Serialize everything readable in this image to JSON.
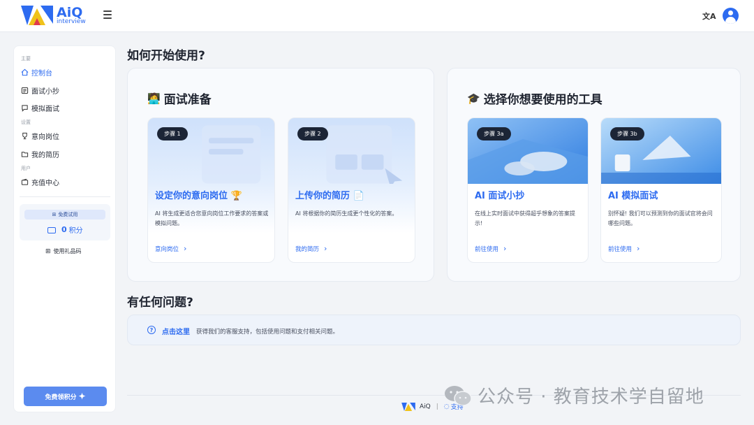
{
  "brand": {
    "word": "AiQ",
    "sub": "interview"
  },
  "topbar": {
    "lang_icon": "translate-icon",
    "user_icon": "user-avatar-icon"
  },
  "sidebar": {
    "section_main": "主要",
    "section_settings": "设置",
    "section_user": "用户",
    "items": [
      {
        "label": "控制台",
        "icon": "home-icon",
        "active": true
      },
      {
        "label": "面试小抄",
        "icon": "cheatsheet-icon"
      },
      {
        "label": "模拟面试",
        "icon": "chat-icon"
      },
      {
        "label": "意向岗位",
        "icon": "trophy-icon"
      },
      {
        "label": "我的简历",
        "icon": "folder-icon"
      },
      {
        "label": "充值中心",
        "icon": "wallet-icon"
      }
    ],
    "free_trial": "免费试用",
    "credits_value": "0",
    "credits_unit": "积分",
    "gift_code": "使用礼品码",
    "free_credits_button": "免费领积分"
  },
  "main": {
    "heading": "如何开始使用?",
    "prep_panel": {
      "emoji": "🧑‍💻",
      "title": "面试准备",
      "cards": [
        {
          "badge": "步骤 1",
          "title": "设定你的意向岗位 🏆",
          "desc": "AI 将生成更适合您意向岗位工作要求的答案或模拟问题。",
          "link": "意向岗位"
        },
        {
          "badge": "步骤 2",
          "title": "上传你的简历 📄",
          "desc": "AI 将根据你的简历生成更个性化的答案。",
          "link": "我的简历"
        }
      ]
    },
    "tools_panel": {
      "emoji": "🎓",
      "title": "选择你想要使用的工具",
      "cards": [
        {
          "badge": "步骤 3a",
          "title": "AI 面试小抄",
          "desc": "在线上实时面试中获得超乎想象的答案提示!",
          "link": "前往使用"
        },
        {
          "badge": "步骤 3b",
          "title": "AI 模拟面试",
          "desc": "别怀疑! 我们可以预测到你的面试官将会问哪些问题。",
          "link": "前往使用"
        }
      ]
    },
    "faq_heading": "有任何问题?",
    "help": {
      "link": "点击这里",
      "text": "获得我们的客服支持，包括使用问题和支付相关问题。"
    }
  },
  "footer": {
    "brand": "AiQ",
    "sep": "|",
    "support": "支持"
  },
  "watermark": "公众号 · 教育技术学自留地",
  "colors": {
    "accent": "#2d6bf0",
    "badge": "#1c2536",
    "button": "#5b8bef"
  }
}
